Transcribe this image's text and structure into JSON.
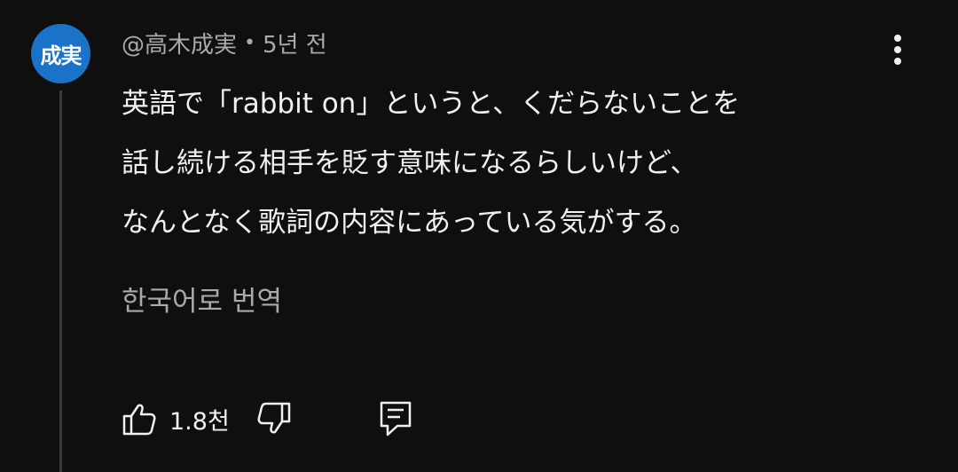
{
  "comment": {
    "avatar_text": "成実",
    "avatar_color": "#1a73c8",
    "author": "@高木成実",
    "separator": "•",
    "time_ago": "5년 전",
    "lines": [
      "英語で「rabbit on」というと、くだらないことを",
      "話し続ける相手を貶す意味になるらしいけど、",
      "なんとなく歌詞の内容にあっている気がする。"
    ],
    "translate_label": "한국어로 번역",
    "like_count": "1.8천"
  },
  "icons": {
    "menu": "more-vert-icon",
    "like": "thumb-up-icon",
    "dislike": "thumb-down-icon",
    "reply": "comment-icon"
  }
}
